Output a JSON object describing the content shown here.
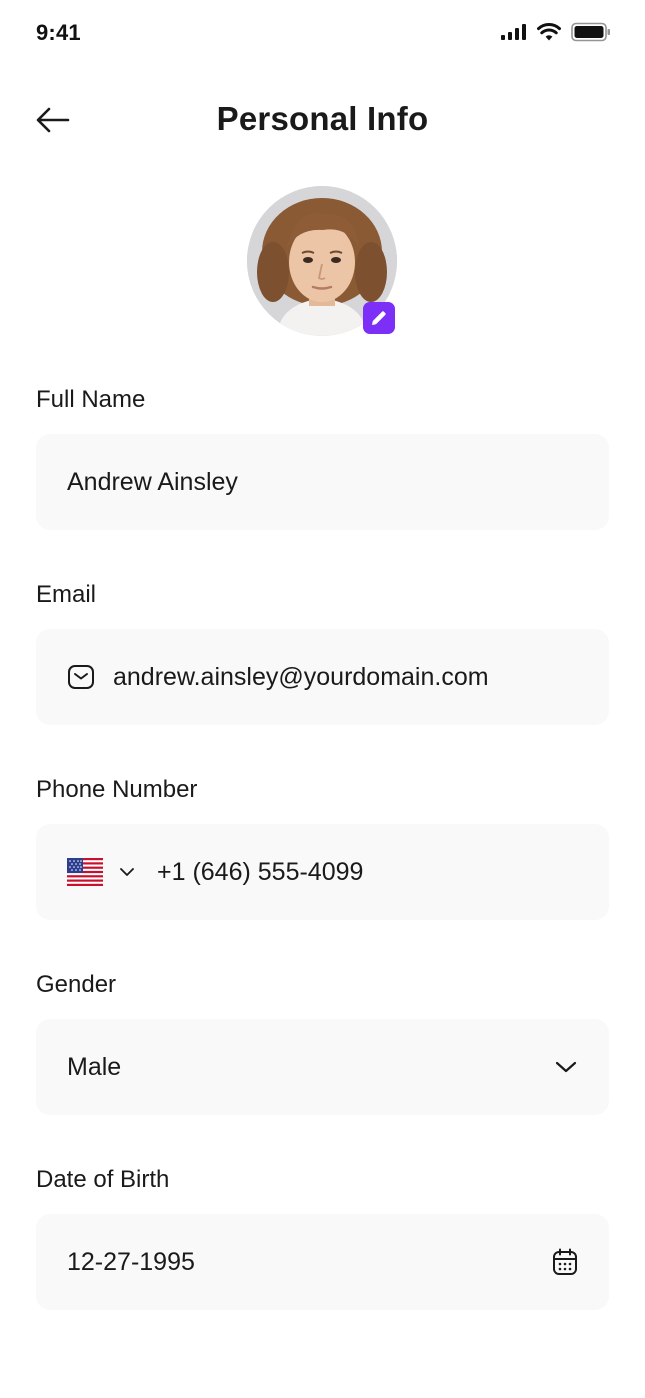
{
  "status": {
    "time": "9:41"
  },
  "header": {
    "title": "Personal Info"
  },
  "profile": {
    "avatar_icon": "user-photo",
    "edit_icon": "pencil-icon",
    "accent": "#7b2ff7"
  },
  "fields": {
    "full_name": {
      "label": "Full Name",
      "value": "Andrew Ainsley"
    },
    "email": {
      "label": "Email",
      "value": "andrew.ainsley@yourdomain.com",
      "icon": "mail-icon"
    },
    "phone": {
      "label": "Phone Number",
      "value": "+1 (646) 555-4099",
      "country_flag": "us-flag-icon"
    },
    "gender": {
      "label": "Gender",
      "value": "Male",
      "icon": "chevron-down-icon"
    },
    "dob": {
      "label": "Date of Birth",
      "value": "12-27-1995",
      "icon": "calendar-icon"
    }
  }
}
